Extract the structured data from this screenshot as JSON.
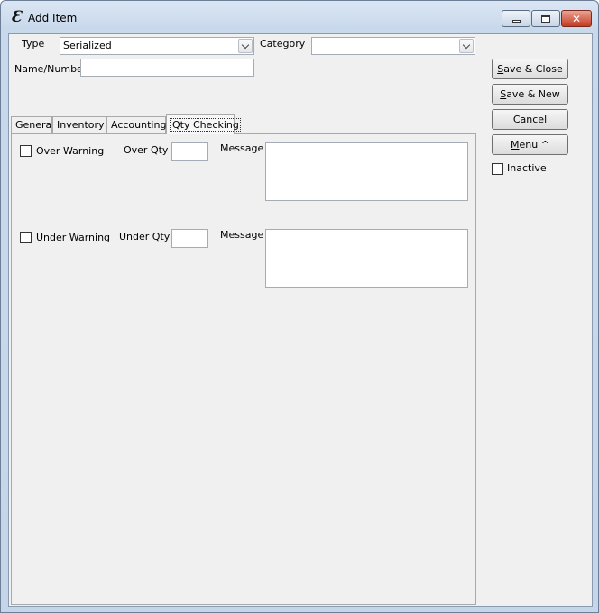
{
  "window": {
    "title": "Add Item",
    "app_icon_glyph": "Ɛ",
    "controls": {
      "minimize_icon": "minimize-icon",
      "maximize_icon": "maximize-icon",
      "close_glyph": "✕"
    }
  },
  "form": {
    "type_label": "Type",
    "type_value": "Serialized",
    "category_label": "Category",
    "category_value": "",
    "name_label": "Name/Number",
    "name_value": ""
  },
  "tabs": [
    {
      "label": "General",
      "active": false
    },
    {
      "label": "Inventory",
      "active": false
    },
    {
      "label": "Accounting",
      "active": false
    },
    {
      "label": "Qty Checking",
      "active": true
    }
  ],
  "qty_checking": {
    "over_warning_label": "Over Warning",
    "over_warning_checked": false,
    "over_qty_label": "Over Qty",
    "over_qty_value": "",
    "over_message_label": "Message",
    "over_message_value": "",
    "under_warning_label": "Under Warning",
    "under_warning_checked": false,
    "under_qty_label": "Under Qty",
    "under_qty_value": "",
    "under_message_label": "Message",
    "under_message_value": ""
  },
  "actions": {
    "save_close": {
      "mnemonic": "S",
      "rest": "ave & Close"
    },
    "save_new": {
      "mnemonic": "S",
      "rest": "ave & New"
    },
    "cancel": "Cancel",
    "menu": {
      "mnemonic": "M",
      "rest": "enu ^"
    },
    "inactive_label": "Inactive",
    "inactive_checked": false
  },
  "colors": {
    "title_gradient_top": "#dbe6f3",
    "client_bg": "#f0f0f0",
    "close_button": "#c53b22"
  }
}
